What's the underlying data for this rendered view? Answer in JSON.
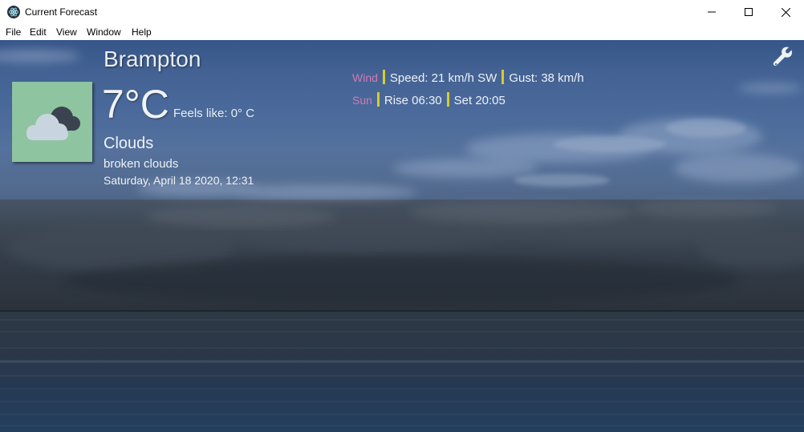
{
  "window": {
    "title": "Current Forecast"
  },
  "menu": {
    "items": [
      "File",
      "Edit",
      "View",
      "Window",
      "Help"
    ]
  },
  "weather": {
    "city": "Brampton",
    "temperature": "7°C",
    "feels_like": "Feels like: 0° C",
    "condition": "Clouds",
    "description": "broken clouds",
    "datetime": "Saturday, April 18 2020, 12:31",
    "icon": "broken-clouds-icon",
    "wind": {
      "label": "Wind",
      "speed": "Speed: 21 km/h SW",
      "gust": "Gust: 38 km/h"
    },
    "sun": {
      "label": "Sun",
      "rise": "Rise 06:30",
      "set": "Set 20:05"
    }
  },
  "colors": {
    "label_color": "#d07ab3",
    "separator_color": "#d8cc2a",
    "icon_background": "#8ec4a0"
  }
}
